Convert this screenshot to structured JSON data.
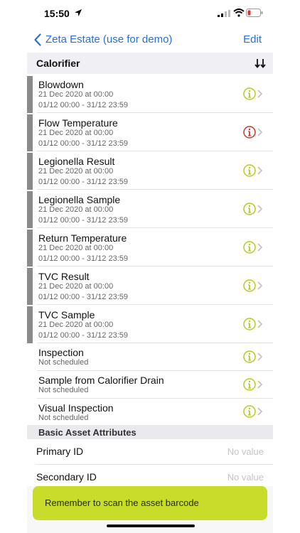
{
  "status": {
    "time": "15:50"
  },
  "nav": {
    "back_label": "Zeta Estate (use for demo)",
    "edit_label": "Edit"
  },
  "section": {
    "title": "Calorifier"
  },
  "tasks": [
    {
      "title": "Blowdown",
      "date": "21 Dec 2020 at 00:00",
      "range": "01/12 00:00 - 31/12 23:59",
      "status": "ok"
    },
    {
      "title": "Flow Temperature",
      "date": "21 Dec 2020 at 00:00",
      "range": "01/12 00:00 - 31/12 23:59",
      "status": "alert"
    },
    {
      "title": "Legionella Result",
      "date": "21 Dec 2020 at 00:00",
      "range": "01/12 00:00 - 31/12 23:59",
      "status": "ok"
    },
    {
      "title": "Legionella Sample",
      "date": "21 Dec 2020 at 00:00",
      "range": "01/12 00:00 - 31/12 23:59",
      "status": "ok"
    },
    {
      "title": "Return Temperature",
      "date": "21 Dec 2020 at 00:00",
      "range": "01/12 00:00 - 31/12 23:59",
      "status": "ok"
    },
    {
      "title": "TVC Result",
      "date": "21 Dec 2020 at 00:00",
      "range": "01/12 00:00 - 31/12 23:59",
      "status": "ok"
    },
    {
      "title": "TVC Sample",
      "date": "21 Dec 2020 at 00:00",
      "range": "01/12 00:00 - 31/12 23:59",
      "status": "ok"
    }
  ],
  "unscheduled": [
    {
      "title": "Inspection",
      "sub": "Not scheduled"
    },
    {
      "title": "Sample from Calorifier Drain",
      "sub": "Not scheduled"
    },
    {
      "title": "Visual Inspection",
      "sub": "Not scheduled"
    }
  ],
  "attributes": {
    "title": "Basic Asset Attributes",
    "items": [
      {
        "label": "Primary ID",
        "value": "No value"
      },
      {
        "label": "Secondary ID",
        "value": "No value"
      }
    ]
  },
  "toast": {
    "text": "Remember to scan the asset barcode"
  },
  "colors": {
    "accent": "#2a6fd6",
    "ok": "#b4cc1e",
    "alert": "#d0342c",
    "toast": "#c8dc2a"
  }
}
